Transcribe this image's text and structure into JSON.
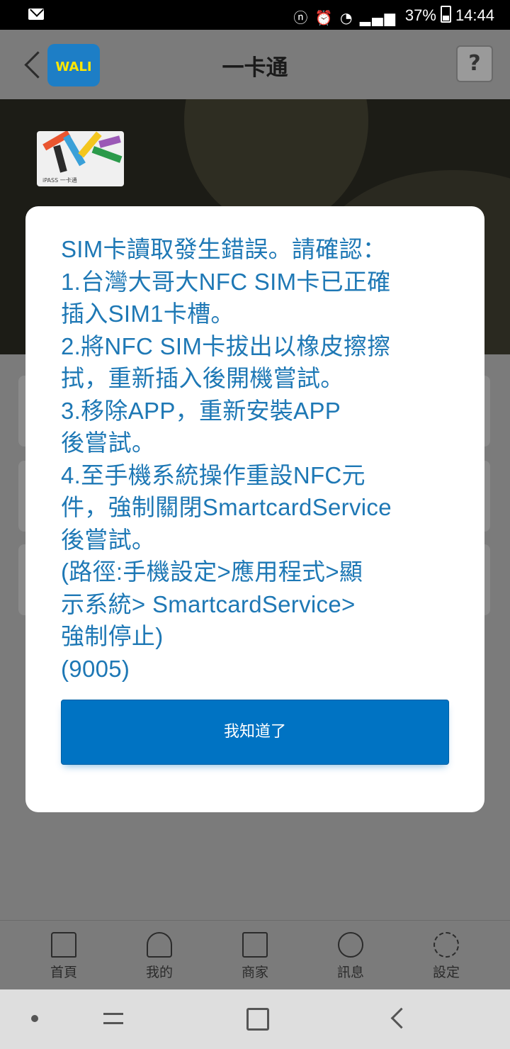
{
  "status_bar": {
    "battery": "37%",
    "time": "14:44"
  },
  "app_bar": {
    "logo_text": "WALI",
    "title": "一卡通",
    "help_label": "?"
  },
  "card": {
    "label": "iPASS 一卡通"
  },
  "dialog": {
    "message": "SIM卡讀取發生錯誤。請確認：\n1.台灣大哥大NFC SIM卡已正確\n插入SIM1卡槽。\n2.將NFC SIM卡拔出以橡皮擦擦\n拭，重新插入後開機嘗試。\n3.移除APP，重新安裝APP\n後嘗試。\n4.至手機系統操作重設NFC元\n件，強制關閉SmartcardService\n後嘗試。\n(路徑:手機設定>應用程式>顯\n示系統> SmartcardService>\n強制停止)\n(9005)",
    "button_label": "我知道了"
  },
  "tabs": [
    {
      "label": "首頁",
      "icon": "home-icon"
    },
    {
      "label": "我的",
      "icon": "user-icon"
    },
    {
      "label": "商家",
      "icon": "store-icon"
    },
    {
      "label": "訊息",
      "icon": "message-icon"
    },
    {
      "label": "設定",
      "icon": "gear-icon"
    }
  ],
  "colors": {
    "dialog_text": "#1e78b5",
    "button_bg": "#0073c3",
    "overlay": "#7b7b7b"
  }
}
